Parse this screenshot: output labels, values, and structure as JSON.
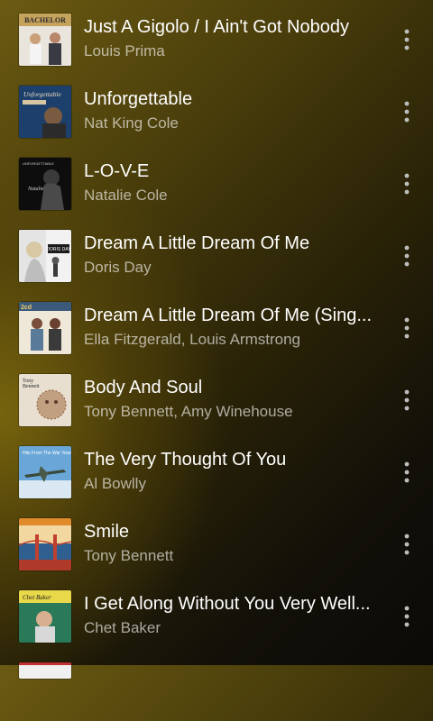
{
  "songs": [
    {
      "title": "Just A Gigolo / I Ain't Got Nobody",
      "artist": "Louis Prima",
      "art_text": "BACHELOR",
      "art_colors": [
        "#e9e4dc",
        "#3a3a44",
        "#c6a35d"
      ]
    },
    {
      "title": "Unforgettable",
      "artist": "Nat King Cole",
      "art_text": "Unforgettable",
      "art_colors": [
        "#1c3f6b",
        "#d6c6a2",
        "#2b2b2b"
      ]
    },
    {
      "title": "L-O-V-E",
      "artist": "Natalie Cole",
      "art_text": "UNFORGETTABLE",
      "art_colors": [
        "#0d0d0d",
        "#4a4a4a",
        "#d8d8d8"
      ]
    },
    {
      "title": "Dream A Little Dream Of Me",
      "artist": "Doris Day",
      "art_text": "DORIS DAY",
      "art_colors": [
        "#f2f2f2",
        "#1a1a1a",
        "#d8c9a4"
      ]
    },
    {
      "title": "Dream A Little Dream Of Me (Sing...",
      "artist": "Ella Fitzgerald, Louis Armstrong",
      "art_text": "ELLA FITZGERALD & LOUIS ARMSTRONG",
      "art_colors": [
        "#efe8d8",
        "#3b5a7a",
        "#7a4f3a"
      ]
    },
    {
      "title": "Body And Soul",
      "artist": "Tony Bennett, Amy Winehouse",
      "art_text": "Tony Bennett",
      "art_colors": [
        "#e8dfd0",
        "#8a5a3a",
        "#c0a080"
      ]
    },
    {
      "title": "The Very Thought Of You",
      "artist": "Al Bowlly",
      "art_text": "Hits From The War Years",
      "art_colors": [
        "#6aa7d8",
        "#d9e8f2",
        "#3a4a3a"
      ]
    },
    {
      "title": "Smile",
      "artist": "Tony Bennett",
      "art_text": "",
      "art_colors": [
        "#e08a2a",
        "#2f5f8f",
        "#b03a2a"
      ]
    },
    {
      "title": "I Get Along Without You Very Well...",
      "artist": "Chet Baker",
      "art_text": "Chet Baker sings",
      "art_colors": [
        "#2a7a5a",
        "#e8d84a",
        "#d8d8d8"
      ]
    }
  ],
  "more_icon": "more-vert-icon"
}
